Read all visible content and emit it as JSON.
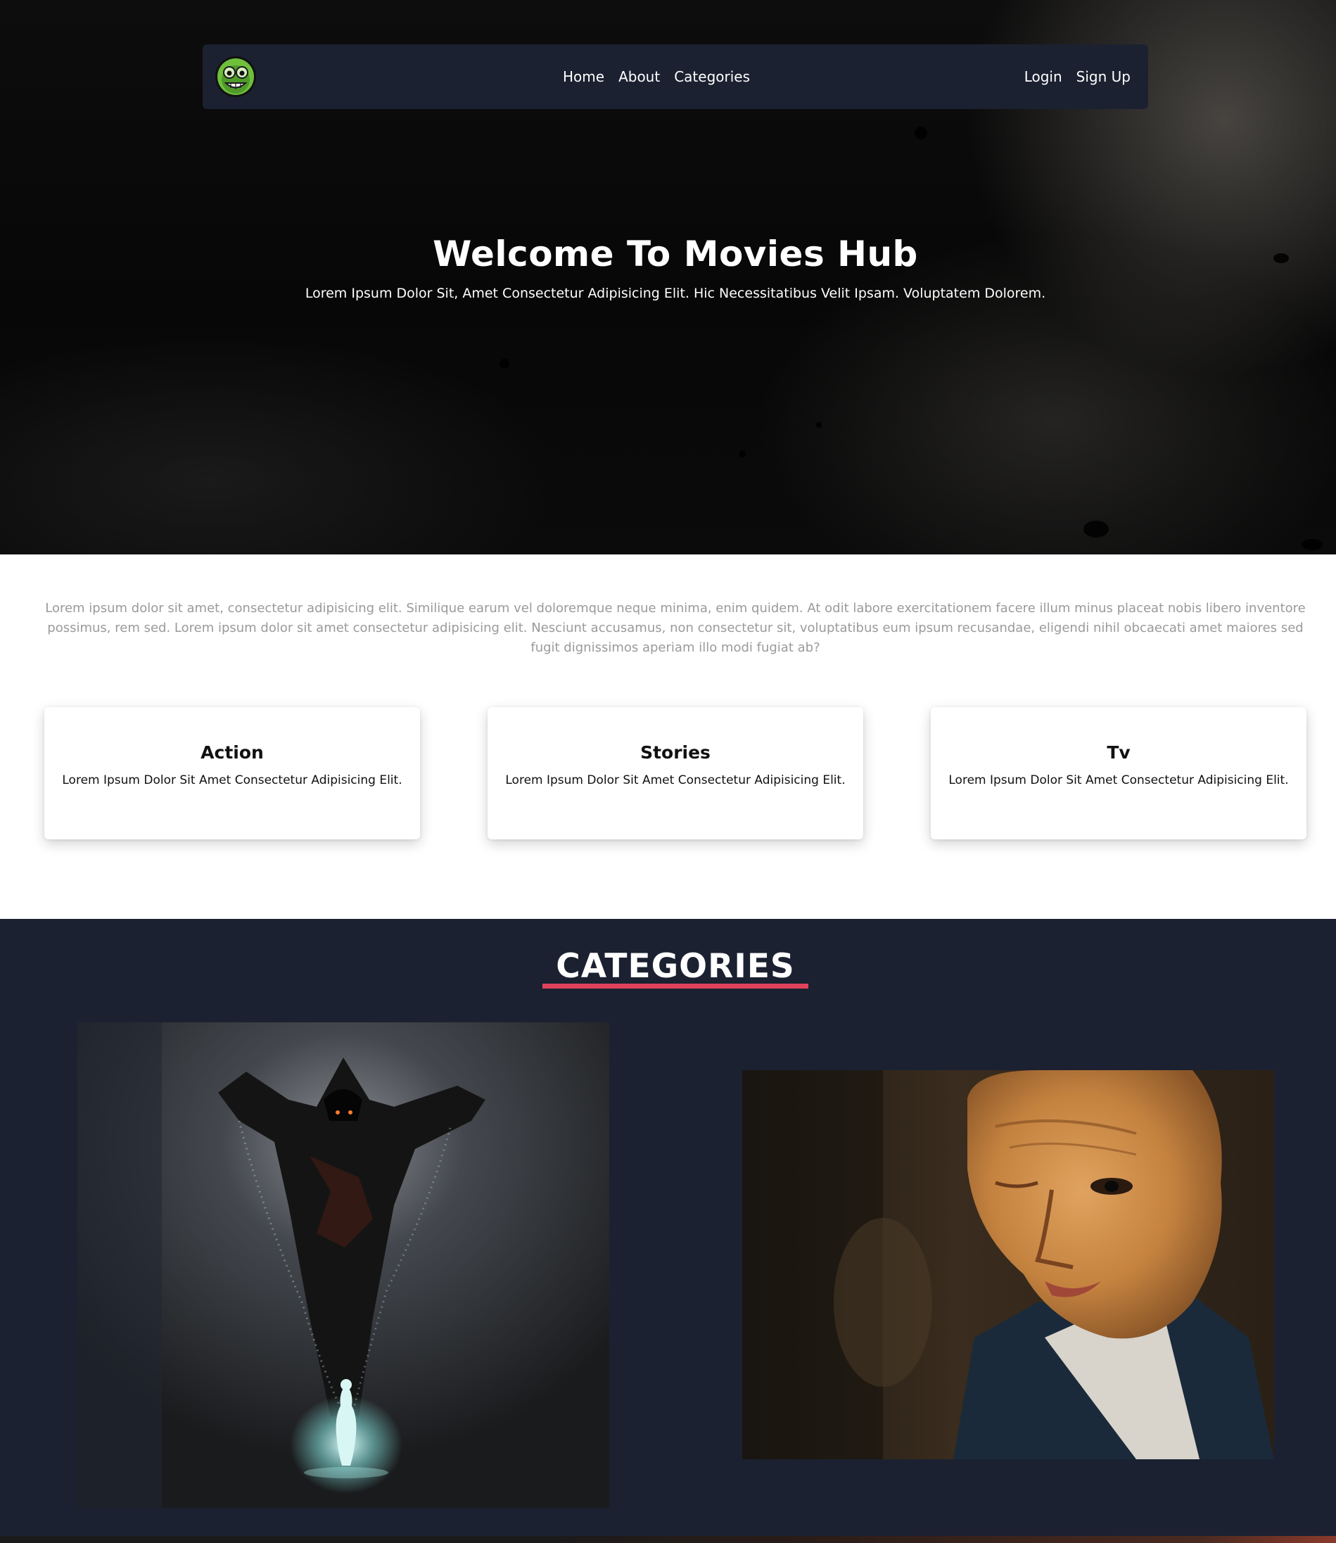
{
  "nav": {
    "logo_alt": "Movies Hub logo",
    "links": [
      "Home",
      "About",
      "Categories"
    ],
    "auth": [
      "Login",
      "Sign Up"
    ]
  },
  "hero": {
    "title": "Welcome To Movies Hub",
    "subtitle": "Lorem Ipsum Dolor Sit, Amet Consectetur Adipisicing Elit. Hic Necessitatibus Velit Ipsam. Voluptatem Dolorem."
  },
  "intro": {
    "text": "Lorem ipsum dolor sit amet, consectetur adipisicing elit. Similique earum vel doloremque neque minima, enim quidem. At odit labore exercitationem facere illum minus placeat nobis libero inventore possimus, rem sed. Lorem ipsum dolor sit amet consectetur adipisicing elit. Nesciunt accusamus, non consectetur sit, voluptatibus eum ipsum recusandae, eligendi nihil obcaecati amet maiores sed fugit dignissimos aperiam illo modi fugiat ab?"
  },
  "cards": [
    {
      "title": "Action",
      "text": "Lorem Ipsum Dolor Sit Amet Consectetur Adipisicing Elit."
    },
    {
      "title": "Stories",
      "text": "Lorem Ipsum Dolor Sit Amet Consectetur Adipisicing Elit."
    },
    {
      "title": "Tv",
      "text": "Lorem Ipsum Dolor Sit Amet Consectetur Adipisicing Elit."
    }
  ],
  "categories": {
    "heading": "CATEGORIES",
    "accent_color": "#e0425c",
    "images": [
      {
        "alt": "Hooded reaper figure above a glowing figure"
      },
      {
        "alt": "Person wearing a wrinkled old-man horror mask"
      }
    ]
  },
  "colors": {
    "navbar": "#1b2130",
    "section_dark": "#1b2130",
    "intro_text": "#9a9a9a"
  }
}
